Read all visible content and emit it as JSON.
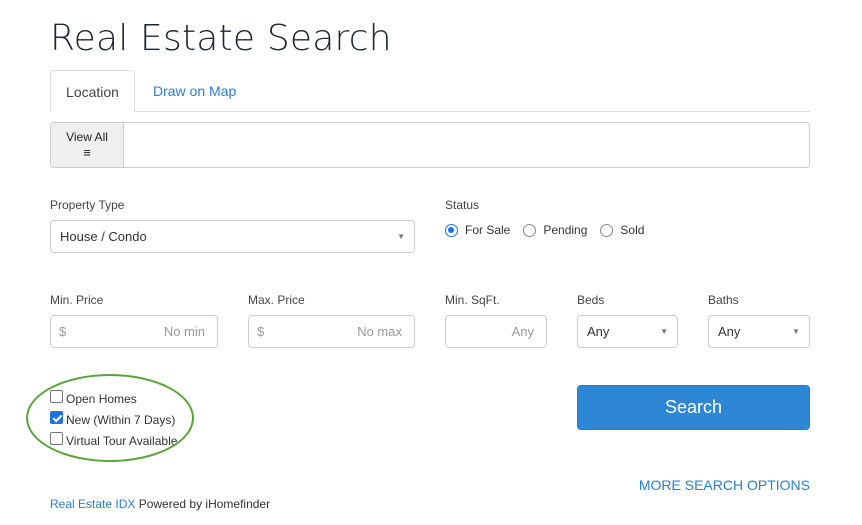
{
  "page": {
    "title": "Real Estate Search"
  },
  "tabs": [
    {
      "label": "Location",
      "active": true
    },
    {
      "label": "Draw on Map",
      "active": false
    }
  ],
  "location": {
    "view_all_label": "View All",
    "view_all_icon": "list-icon",
    "input_value": "",
    "input_placeholder": ""
  },
  "property_type": {
    "label": "Property Type",
    "selected": "House / Condo"
  },
  "status": {
    "label": "Status",
    "options": [
      {
        "label": "For Sale",
        "checked": true
      },
      {
        "label": "Pending",
        "checked": false
      },
      {
        "label": "Sold",
        "checked": false
      }
    ]
  },
  "min_price": {
    "label": "Min. Price",
    "prefix": "$",
    "placeholder": "No min"
  },
  "max_price": {
    "label": "Max. Price",
    "prefix": "$",
    "placeholder": "No max"
  },
  "min_sqft": {
    "label": "Min. SqFt.",
    "placeholder": "Any"
  },
  "beds": {
    "label": "Beds",
    "selected": "Any"
  },
  "baths": {
    "label": "Baths",
    "selected": "Any"
  },
  "filters": [
    {
      "label": "Open Homes",
      "checked": false
    },
    {
      "label": "New (Within 7 Days)",
      "checked": true
    },
    {
      "label": "Virtual Tour Available",
      "checked": false
    }
  ],
  "search_button": "Search",
  "more_options": "MORE SEARCH OPTIONS",
  "footer": {
    "link": "Real Estate IDX",
    "text": " Powered by iHomefinder"
  },
  "colors": {
    "accent": "#2e87d4",
    "link": "#2a7fd1",
    "highlight_ellipse": "#5aa33a"
  }
}
